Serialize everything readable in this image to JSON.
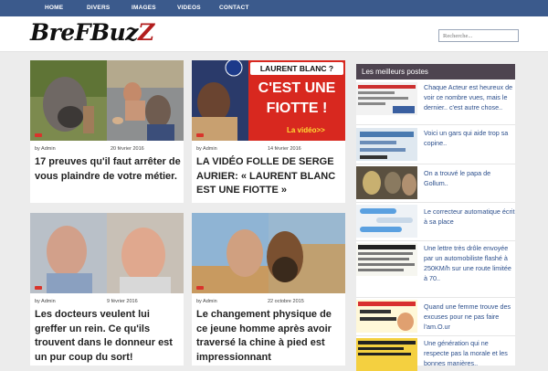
{
  "nav": {
    "items": [
      "HOME",
      "DIVERS",
      "IMAGES",
      "VIDEOS",
      "CONTACT"
    ]
  },
  "header": {
    "logo_main": "BreFBuz",
    "logo_accent": "Z"
  },
  "search": {
    "placeholder": "Recherche..."
  },
  "articles": [
    {
      "author": "by Admin",
      "date": "20 février 2016",
      "title": "17 preuves qu'il faut arrêter de vous plaindre de votre métier."
    },
    {
      "author": "by Admin",
      "date": "14 février 2016",
      "title": "LA VIDÉO FOLLE DE SERGE AURIER: « LAURENT BLANC EST UNE FIOTTE »"
    },
    {
      "author": "by Admin",
      "date": "9 février 2016",
      "title": "Les docteurs veulent lui greffer un rein. Ce qu'ils trouvent dans le donneur est un pur coup du sort!"
    },
    {
      "author": "by Admin",
      "date": "22 octobre 2015",
      "title": "Le changement physique de ce jeune homme après avoir traversé la chine à pied est impressionnant"
    }
  ],
  "article_images": {
    "aurier_line1": "LAURENT BLANC ?",
    "aurier_line2": "C'EST UNE",
    "aurier_line3": "FIOTTE !",
    "aurier_cta": "La vidéo>>"
  },
  "sidebar": {
    "heading": "Les meilleurs postes",
    "posts": [
      "Chaque Acteur est heureux de voir ce nombre vues, mais le dernier.. c'est autre chose..",
      "Voici un gars qui aide trop sa copine..",
      "On a trouvé le papa de Gollum..",
      "Le correcteur automatique écrit à sa place",
      "Une lettre très drôle envoyée par un automobiliste flashé à 250KM/h sur une route limitée à 70..",
      "Quand une femme trouve des excuses pour ne pas faire l'am.O.ur",
      "Une génération qui ne respecte pas la morale et les bonnes manières.."
    ]
  },
  "colors": {
    "nav_bg": "#3b5a8c",
    "sidebar_head": "#4e4450",
    "link": "#2c4f8c",
    "accent": "#b21d1d"
  }
}
